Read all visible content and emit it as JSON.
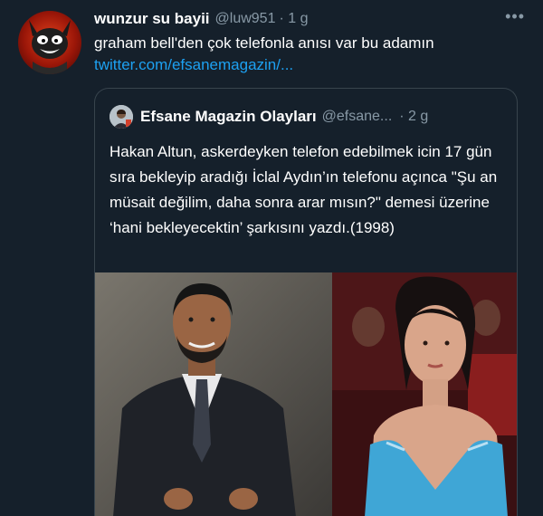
{
  "tweet": {
    "author_name": "wunzur su bayii",
    "handle": "@luw951",
    "time": "· 1 g",
    "text": "graham bell'den çok telefonla anısı var bu adamın",
    "link": "twitter.com/efsanemagazin/..."
  },
  "quote": {
    "author_name": "Efsane Magazin Olayları",
    "handle": "@efsane...",
    "time": "· 2 g",
    "text": "Hakan Altun, askerdeyken telefon edebilmek icin 17 gün sıra bekleyip aradığı İclal Aydın’ın telefonu açınca \"Şu an müsait değilim, daha sonra arar mısın?\" demesi üzerine ‘hani bekleyecektin’ şarkısını yazdı.(1998)"
  },
  "icons": {
    "more": "more-horizontal-icon"
  },
  "colors": {
    "background": "#15202b",
    "link": "#1da1f2",
    "secondary_text": "#8899a6",
    "border": "#38444d"
  }
}
